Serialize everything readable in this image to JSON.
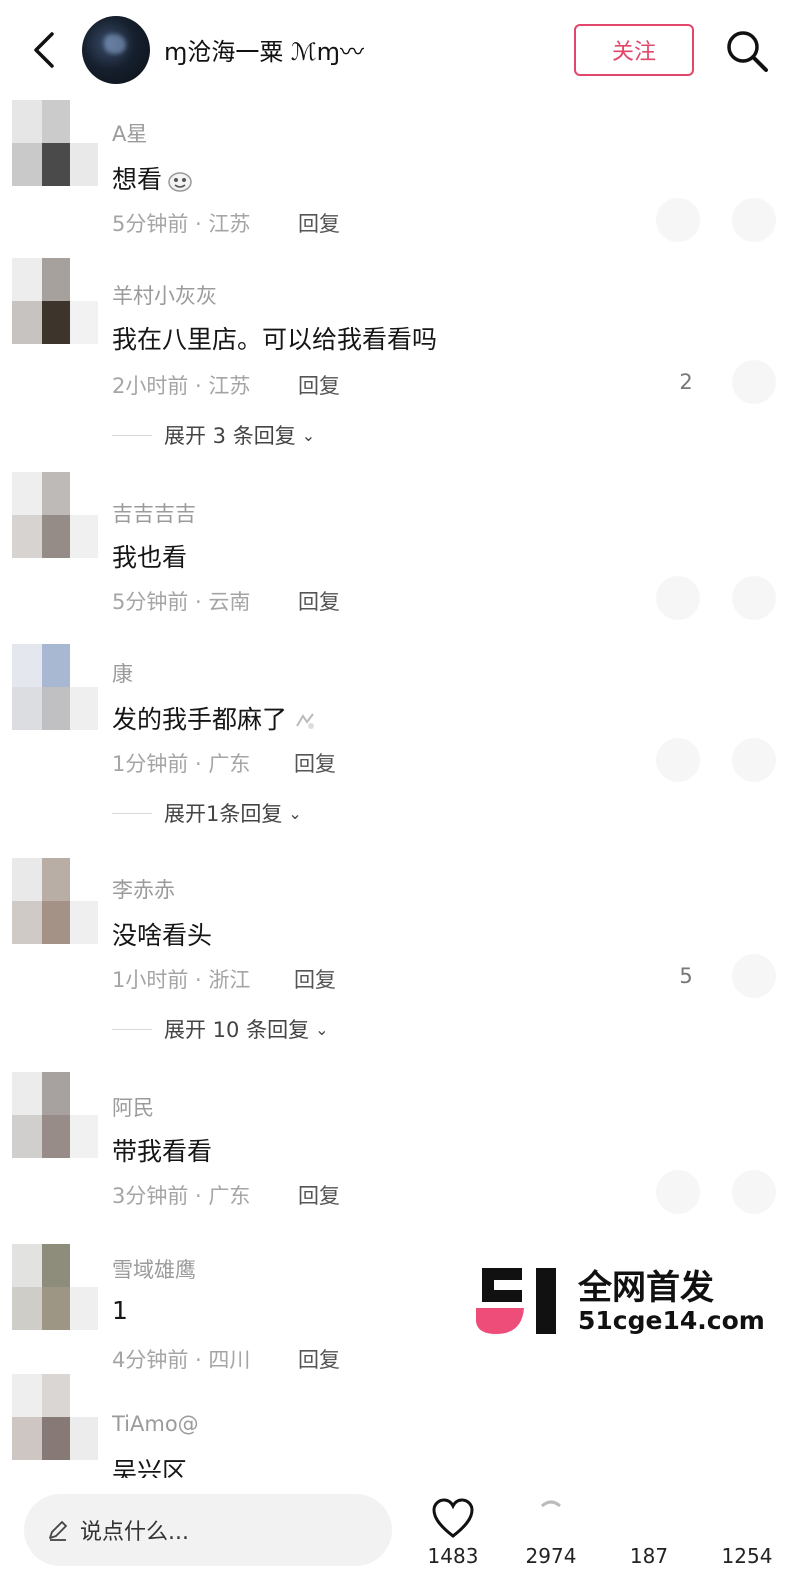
{
  "header": {
    "title": "ɱ沧海一粟 ℳɱ〰",
    "follow_label": "关注"
  },
  "comments": [
    {
      "name": "A星",
      "text": "想看",
      "meta": "5分钟前 · 江苏",
      "reply": "回复",
      "count": "",
      "expand": ""
    },
    {
      "name": "羊村小灰灰",
      "text": "我在八里店。可以给我看看吗",
      "meta": "2小时前 · 江苏",
      "reply": "回复",
      "count": "2",
      "expand": "展开 3 条回复"
    },
    {
      "name": "吉吉吉吉",
      "text": "我也看",
      "meta": "5分钟前 · 云南",
      "reply": "回复",
      "count": "",
      "expand": ""
    },
    {
      "name": "康",
      "text": "发的我手都麻了",
      "meta": "1分钟前 · 广东",
      "reply": "回复",
      "count": "",
      "expand": "展开1条回复"
    },
    {
      "name": "李赤赤",
      "text": "没啥看头",
      "meta": "1小时前 · 浙江",
      "reply": "回复",
      "count": "5",
      "expand": "展开 10 条回复"
    },
    {
      "name": "阿民",
      "text": "带我看看",
      "meta": "3分钟前 · 广东",
      "reply": "回复",
      "count": "",
      "expand": ""
    },
    {
      "name": "雪域雄鹰",
      "text": "1",
      "meta": "4分钟前 · 四川",
      "reply": "回复",
      "count": "",
      "expand": ""
    },
    {
      "name": "TiAmo@",
      "text": "吴兴区",
      "meta": "",
      "reply": "",
      "count": "",
      "expand": ""
    }
  ],
  "watermark": {
    "title": "全网首发",
    "domain": "51cge14.com"
  },
  "bottom": {
    "input_placeholder": "说点什么...",
    "likes": "1483",
    "favorites": "2974",
    "comments": "187",
    "shares": "1254"
  }
}
